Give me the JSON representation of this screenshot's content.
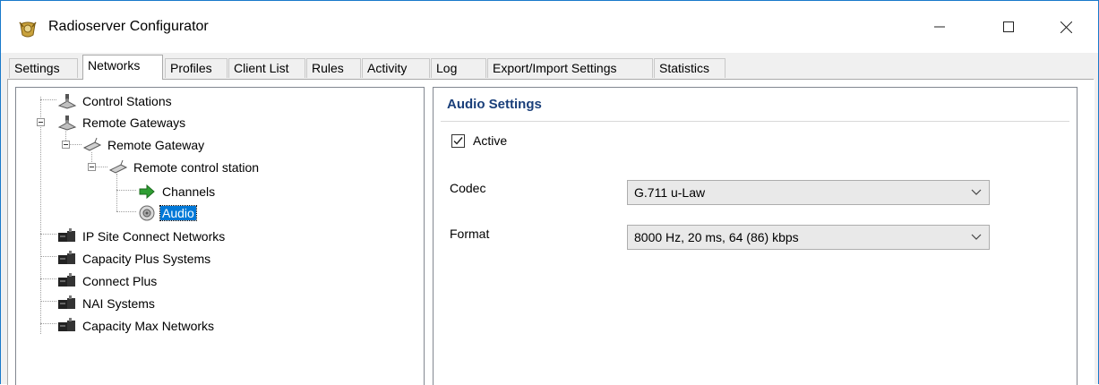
{
  "window": {
    "title": "Radioserver Configurator",
    "controls": {
      "minimize": "—",
      "maximize": "☐",
      "close": "✕"
    }
  },
  "tabs": [
    "Settings",
    "Networks",
    "Profiles",
    "Client List",
    "Rules",
    "Activity",
    "Log",
    "Export/Import Settings",
    "Statistics"
  ],
  "active_tab": "Networks",
  "tree": [
    {
      "label": "Control Stations",
      "icon": "network-node-icon",
      "selected": false
    },
    {
      "label": "Remote Gateways",
      "icon": "network-node-icon",
      "selected": false
    },
    {
      "label": "Remote Gateway",
      "icon": "gateway-icon",
      "selected": false
    },
    {
      "label": "Remote control station",
      "icon": "gateway-icon",
      "selected": false
    },
    {
      "label": "Channels",
      "icon": "green-arrow-icon",
      "selected": false
    },
    {
      "label": "Audio",
      "icon": "speaker-icon",
      "selected": true
    },
    {
      "label": "IP Site Connect Networks",
      "icon": "network-system-icon",
      "selected": false
    },
    {
      "label": "Capacity Plus Systems",
      "icon": "network-system-icon",
      "selected": false
    },
    {
      "label": "Connect Plus",
      "icon": "network-system-icon",
      "selected": false
    },
    {
      "label": "NAI Systems",
      "icon": "network-system-icon",
      "selected": false
    },
    {
      "label": "Capacity Max Networks",
      "icon": "network-system-icon",
      "selected": false
    }
  ],
  "audio_settings": {
    "title": "Audio Settings",
    "active": {
      "label": "Active",
      "checked": true
    },
    "codec": {
      "label": "Codec",
      "value": "G.711 u-Law"
    },
    "format": {
      "label": "Format",
      "value": "8000 Hz, 20 ms, 64 (86) kbps"
    }
  }
}
